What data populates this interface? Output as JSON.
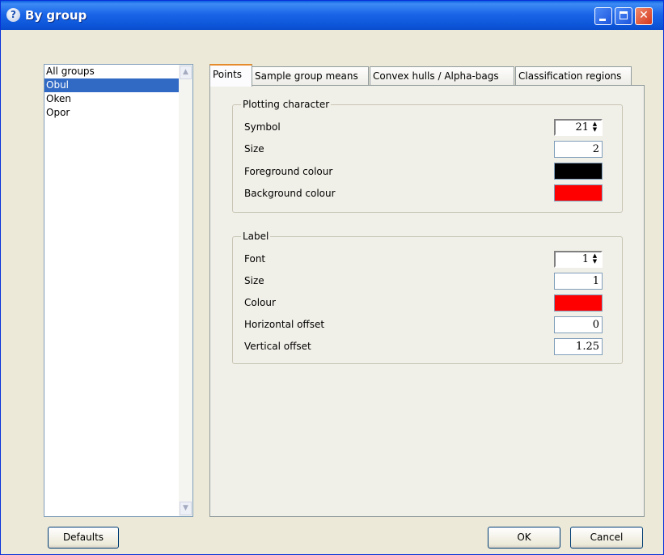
{
  "window": {
    "title": "By group"
  },
  "groups": [
    "All groups",
    "Obul",
    "Oken",
    "Opor"
  ],
  "selected_group_index": 1,
  "tabs": [
    "Points",
    "Sample group means",
    "Convex hulls / Alpha-bags",
    "Classification regions"
  ],
  "active_tab_index": 0,
  "plotting": {
    "legend": "Plotting character",
    "symbol_label": "Symbol",
    "symbol_value": "21",
    "size_label": "Size",
    "size_value": "2",
    "fg_label": "Foreground colour",
    "fg_color": "#000000",
    "bg_label": "Background colour",
    "bg_color": "#ff0000"
  },
  "label": {
    "legend": "Label",
    "font_label": "Font",
    "font_value": "1",
    "size_label": "Size",
    "size_value": "1",
    "colour_label": "Colour",
    "colour_color": "#ff0000",
    "hoffset_label": "Horizontal offset",
    "hoffset_value": "0",
    "voffset_label": "Vertical offset",
    "voffset_value": "1.25"
  },
  "buttons": {
    "defaults": "Defaults",
    "ok": "OK",
    "cancel": "Cancel"
  }
}
